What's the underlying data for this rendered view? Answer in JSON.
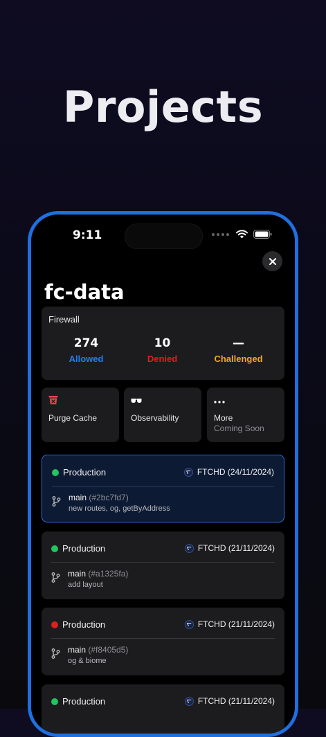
{
  "hero": {
    "title": "Projects"
  },
  "status_bar": {
    "time": "9:11"
  },
  "page": {
    "title": "fc-data"
  },
  "firewall": {
    "label": "Firewall",
    "stats": [
      {
        "value": "274",
        "label": "Allowed",
        "color": "#1f7ef5"
      },
      {
        "value": "10",
        "label": "Denied",
        "color": "#e01e1e"
      },
      {
        "value": "—",
        "label": "Challenged",
        "color": "#f5a623"
      }
    ]
  },
  "actions": [
    {
      "label": "Purge Cache",
      "icon": "trash-icon",
      "sub": ""
    },
    {
      "label": "Observability",
      "icon": "glasses-icon",
      "sub": ""
    },
    {
      "label": "More",
      "icon": "ellipsis-icon",
      "sub": "Coming Soon"
    }
  ],
  "deployments": [
    {
      "env": "Production",
      "status": "ready",
      "status_color": "#22c55e",
      "author": "FTCHD (24/11/2024)",
      "branch": "main",
      "commit": "(#2bc7fd7)",
      "message": "new routes, og, getByAddress",
      "active": true
    },
    {
      "env": "Production",
      "status": "ready",
      "status_color": "#22c55e",
      "author": "FTCHD (21/11/2024)",
      "branch": "main",
      "commit": "(#a1325fa)",
      "message": "add layout",
      "active": false
    },
    {
      "env": "Production",
      "status": "error",
      "status_color": "#e01e1e",
      "author": "FTCHD (21/11/2024)",
      "branch": "main",
      "commit": "(#f8405d5)",
      "message": "og & biome",
      "active": false
    },
    {
      "env": "Production",
      "status": "ready",
      "status_color": "#22c55e",
      "author": "FTCHD (21/11/2024)",
      "branch": "",
      "commit": "",
      "message": "",
      "active": false
    }
  ]
}
